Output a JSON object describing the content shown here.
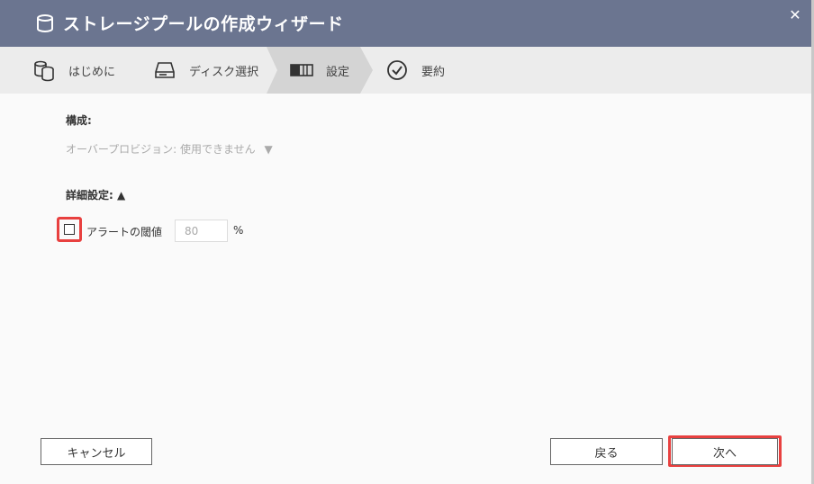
{
  "window": {
    "title": "ストレージプールの作成ウィザード",
    "close_glyph": "✕"
  },
  "steps": [
    {
      "label": "はじめに",
      "icon": "database-icon",
      "active": false
    },
    {
      "label": "ディスク選択",
      "icon": "disk-drive-icon",
      "active": false
    },
    {
      "label": "設定",
      "icon": "settings-bar-icon",
      "active": true
    },
    {
      "label": "要約",
      "icon": "checkmark-circle-icon",
      "active": false
    }
  ],
  "config": {
    "heading": "構成:",
    "overprovision_text": "オーバープロビジョン: 使用できません",
    "dropdown_glyph": "▼"
  },
  "advanced": {
    "heading": "詳細設定: ▲",
    "alert_label": "アラートの閾値",
    "alert_value": "80",
    "alert_checked": false,
    "unit": "%"
  },
  "buttons": {
    "cancel": "キャンセル",
    "back": "戻る",
    "next": "次へ"
  },
  "colors": {
    "titlebar": "#6b7590",
    "highlight": "#e8403f",
    "active_step": "#d4d4d4"
  }
}
